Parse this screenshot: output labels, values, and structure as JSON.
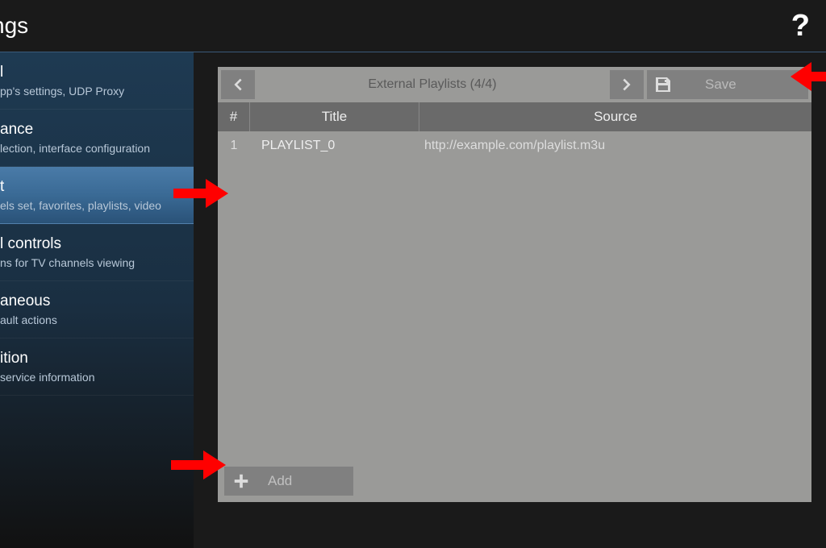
{
  "header": {
    "title": "ngs"
  },
  "sidebar": {
    "items": [
      {
        "title": "l",
        "desc": "pp's settings, UDP Proxy",
        "selected": false
      },
      {
        "title": "ance",
        "desc": "lection, interface configuration",
        "selected": false
      },
      {
        "title": "t",
        "desc": "els set, favorites, playlists, video",
        "selected": true
      },
      {
        "title": "l controls",
        "desc": "ns for TV channels viewing",
        "selected": false
      },
      {
        "title": "aneous",
        "desc": "ault actions",
        "selected": false
      },
      {
        "title": "ition",
        "desc": "service information",
        "selected": false
      }
    ]
  },
  "toolbar": {
    "title": "External Playlists (4/4)",
    "save_label": "Save"
  },
  "table": {
    "headers": {
      "index": "#",
      "title": "Title",
      "source": "Source"
    },
    "rows": [
      {
        "index": "1",
        "title": "PLAYLIST_0",
        "source": "http://example.com/playlist.m3u"
      }
    ]
  },
  "add": {
    "label": "Add"
  }
}
